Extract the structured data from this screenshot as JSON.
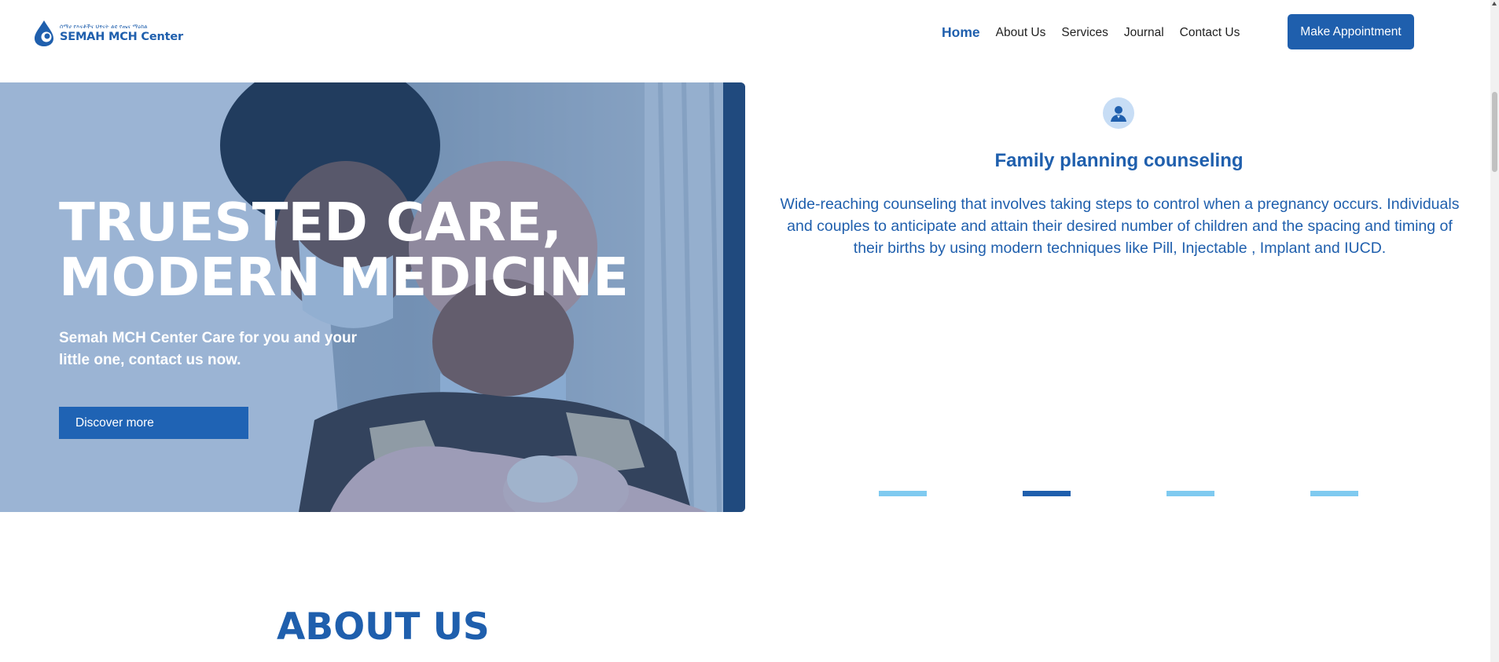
{
  "header": {
    "logo": {
      "tagline": "ሰማሀ የእናቶችና ህፃናት ልዩ የጤና ማዕከል",
      "name": "SEMAH MCH Center"
    },
    "nav": [
      "Home",
      "About Us",
      "Services",
      "Journal",
      "Contact Us"
    ],
    "active_nav": "Home",
    "appointment_label": "Make Appointment"
  },
  "hero": {
    "title_line1": "TRUESTED CARE,",
    "title_line2": "MODERN MEDICINE",
    "subtitle": "Semah MCH Center Care for you and your little one, contact us now.",
    "button_label": "Discover more"
  },
  "service_slide": {
    "icon": "user-icon",
    "title": "Family planning counseling",
    "description": "Wide-reaching counseling that involves taking steps to control when a pregnancy occurs. Individuals and couples to anticipate and attain their desired number of children and the spacing and timing of their births by using modern techniques like Pill, Injectable , Implant and IUCD.",
    "slide_count": 4,
    "active_slide": 2
  },
  "about": {
    "title": "ABOUT US"
  },
  "colors": {
    "brand_blue": "#1f5fad",
    "light_blue": "#7fcaf0",
    "icon_bg": "#c7ddf5"
  }
}
